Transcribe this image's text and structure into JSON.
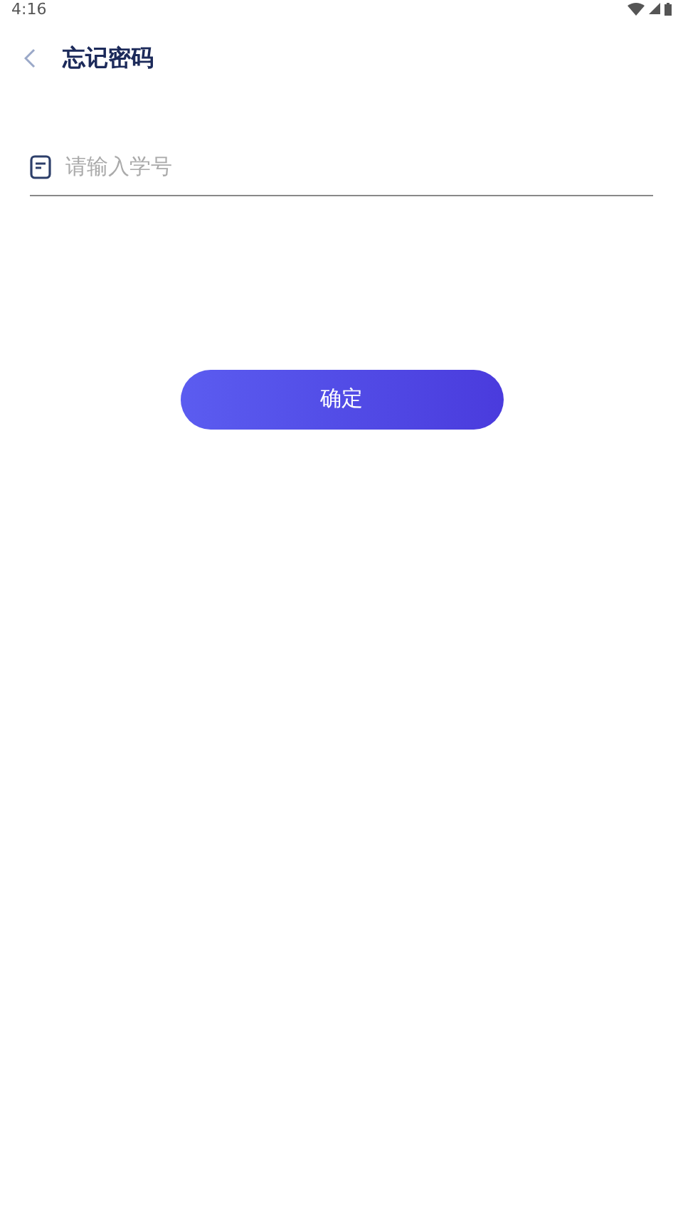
{
  "status_bar": {
    "time": "4:16"
  },
  "header": {
    "title": "忘记密码"
  },
  "form": {
    "student_id": {
      "placeholder": "请输入学号"
    }
  },
  "confirm_button": {
    "label": "确定"
  }
}
